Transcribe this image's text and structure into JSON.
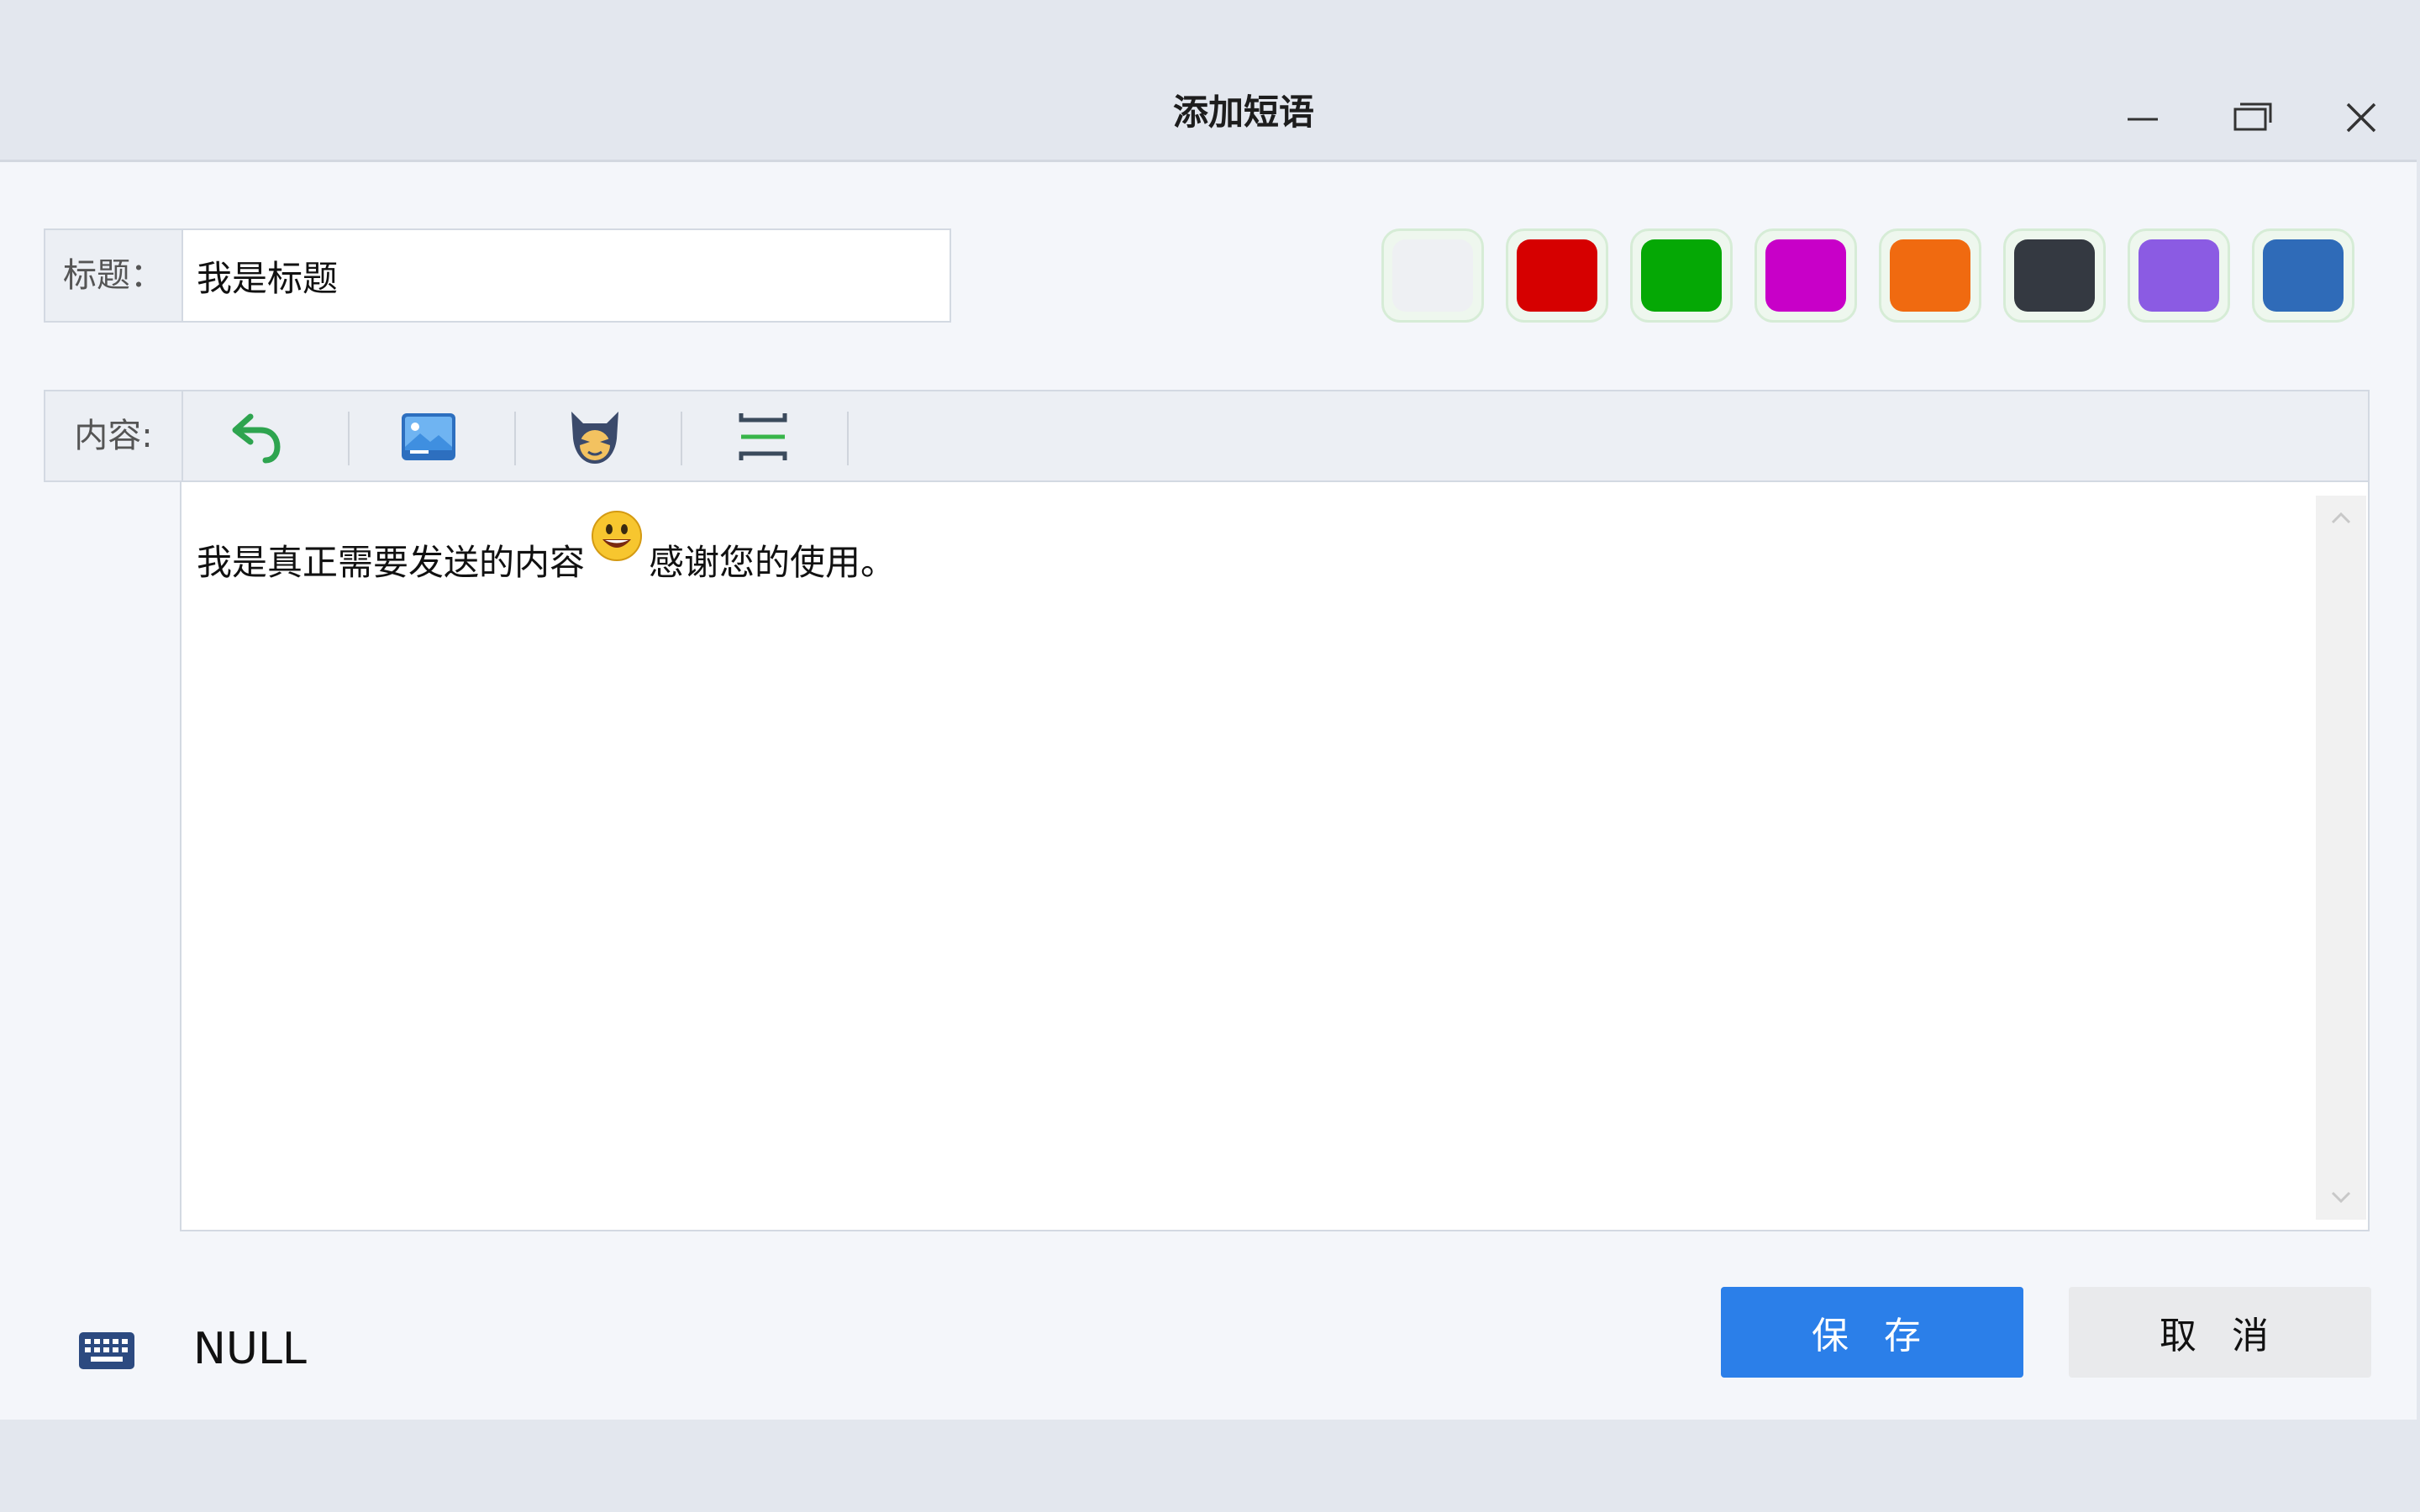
{
  "window": {
    "title": "添加短语"
  },
  "form": {
    "title_label": "标题：",
    "title_value": "我是标题",
    "content_label": "内容:",
    "content_text_before": "我是真正需要发送的内容",
    "content_text_after": "感谢您的使用。"
  },
  "colors": {
    "swatches": [
      "#eef0f3",
      "#d60000",
      "#05a805",
      "#c800c8",
      "#f06a10",
      "#343941",
      "#8b5be3",
      "#2f6bb8"
    ],
    "accent": "#2b7fe9"
  },
  "toolbar": {
    "icons": [
      "undo-icon",
      "image-icon",
      "emoji-icon",
      "line-break-icon"
    ]
  },
  "status": {
    "text": "NULL"
  },
  "buttons": {
    "save": "保 存",
    "cancel": "取 消"
  }
}
